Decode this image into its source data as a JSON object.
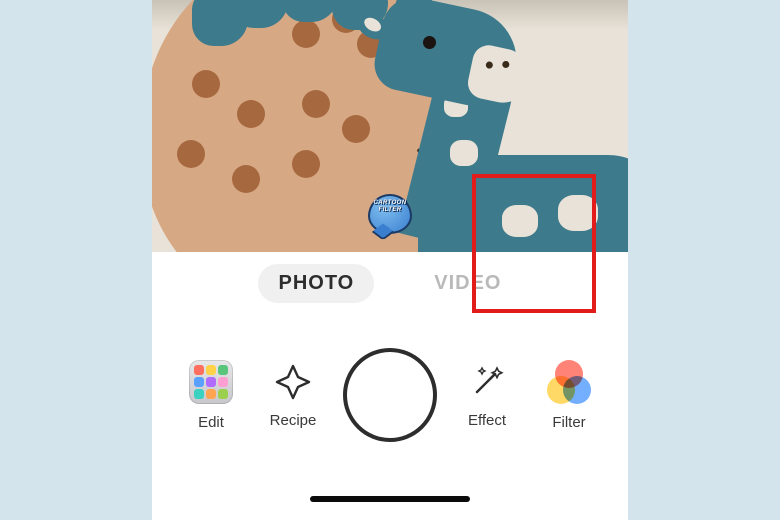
{
  "badge": {
    "line1": "CARTOON",
    "line2": "FILTER"
  },
  "tabs": {
    "photo": "PHOTO",
    "video": "VIDEO",
    "active": "photo"
  },
  "tools": {
    "edit": {
      "label": "Edit"
    },
    "recipe": {
      "label": "Recipe"
    },
    "effect": {
      "label": "Effect"
    },
    "filter": {
      "label": "Filter"
    }
  },
  "highlight": {
    "target": "photo-tab"
  }
}
